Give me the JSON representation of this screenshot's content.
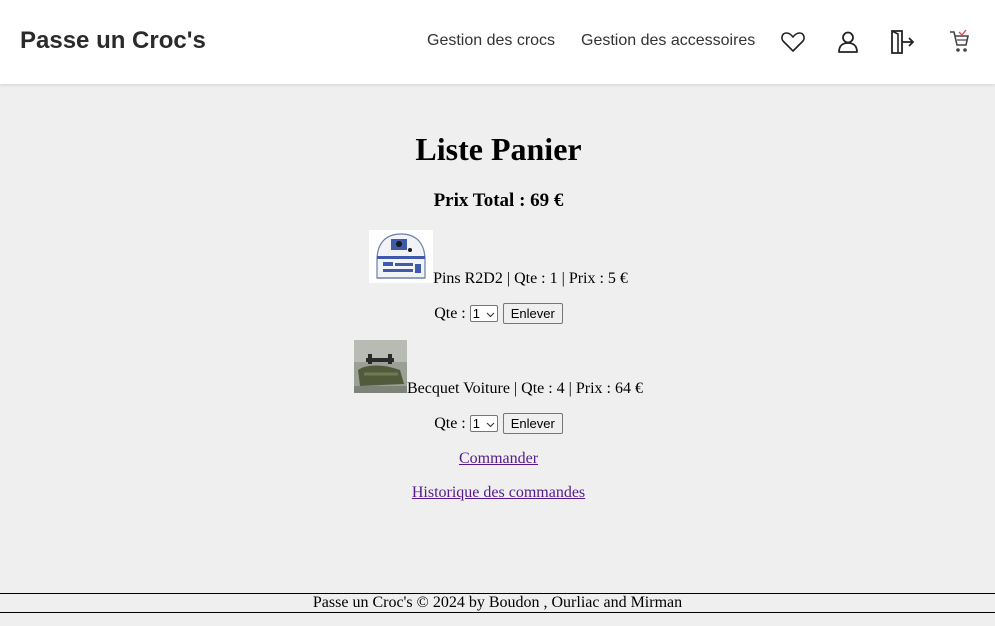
{
  "brand": "Passe un Croc's",
  "nav": {
    "links": [
      "Gestion des crocs",
      "Gestion des accessoires"
    ],
    "icons": [
      "heart-icon",
      "user-icon",
      "logout-icon",
      "cart-icon"
    ]
  },
  "page": {
    "title": "Liste Panier",
    "total": "Prix Total : 69 €"
  },
  "items": [
    {
      "name": "Pins R2D2",
      "details": "Pins R2D2 | Qte : 1 | Prix : 5 €",
      "qty_label": "Qte :",
      "qty_selected": "1",
      "remove_label": "Enlever"
    },
    {
      "name": "Becquet Voiture",
      "details": "Becquet Voiture | Qte : 4 | Prix : 64 €",
      "qty_label": "Qte :",
      "qty_selected": "1",
      "remove_label": "Enlever"
    }
  ],
  "actions": {
    "order": "Commander",
    "history": "Historique des commandes"
  },
  "footer": "Passe un Croc's © 2024 by Boudon , Ourliac and Mirman"
}
